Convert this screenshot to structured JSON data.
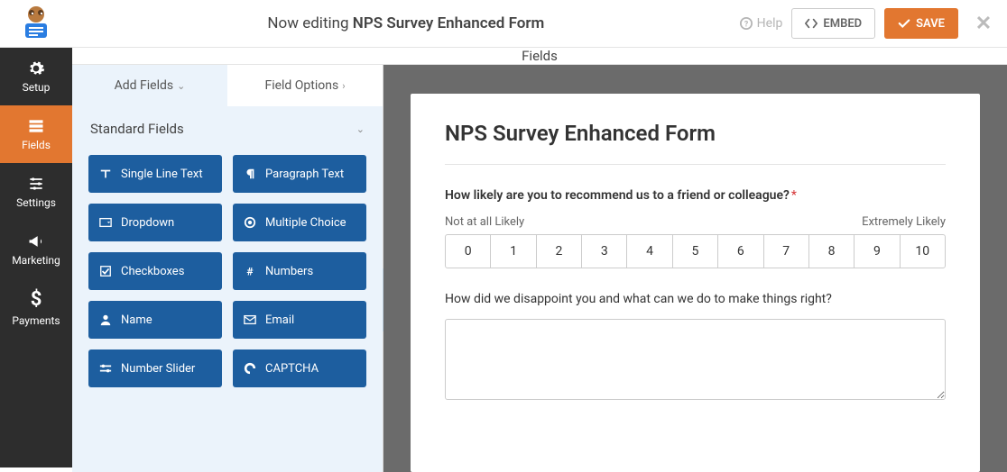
{
  "topbar": {
    "title_prefix": "Now editing ",
    "title_bold": "NPS Survey Enhanced Form",
    "help": "Help",
    "embed": "EMBED",
    "save": "SAVE"
  },
  "nav": [
    {
      "label": "Setup",
      "icon": "gear"
    },
    {
      "label": "Fields",
      "icon": "form"
    },
    {
      "label": "Settings",
      "icon": "sliders"
    },
    {
      "label": "Marketing",
      "icon": "bullhorn"
    },
    {
      "label": "Payments",
      "icon": "dollar"
    }
  ],
  "nav_active_index": 1,
  "panel_header": "Fields",
  "sub_tabs": {
    "add": "Add Fields",
    "options": "Field Options"
  },
  "section_title": "Standard Fields",
  "field_buttons": [
    {
      "label": "Single Line Text",
      "icon": "text"
    },
    {
      "label": "Paragraph Text",
      "icon": "para"
    },
    {
      "label": "Dropdown",
      "icon": "dropdown"
    },
    {
      "label": "Multiple Choice",
      "icon": "radio"
    },
    {
      "label": "Checkboxes",
      "icon": "check"
    },
    {
      "label": "Numbers",
      "icon": "hash"
    },
    {
      "label": "Name",
      "icon": "user"
    },
    {
      "label": "Email",
      "icon": "mail"
    },
    {
      "label": "Number Slider",
      "icon": "slider"
    },
    {
      "label": "CAPTCHA",
      "icon": "captcha"
    }
  ],
  "form": {
    "title": "NPS Survey Enhanced Form",
    "q1": "How likely are you to recommend us to a friend or colleague?",
    "scale_low": "Not at all Likely",
    "scale_high": "Extremely Likely",
    "scale": [
      "0",
      "1",
      "2",
      "3",
      "4",
      "5",
      "6",
      "7",
      "8",
      "9",
      "10"
    ],
    "q2": "How did we disappoint you and what can we do to make things right?"
  }
}
